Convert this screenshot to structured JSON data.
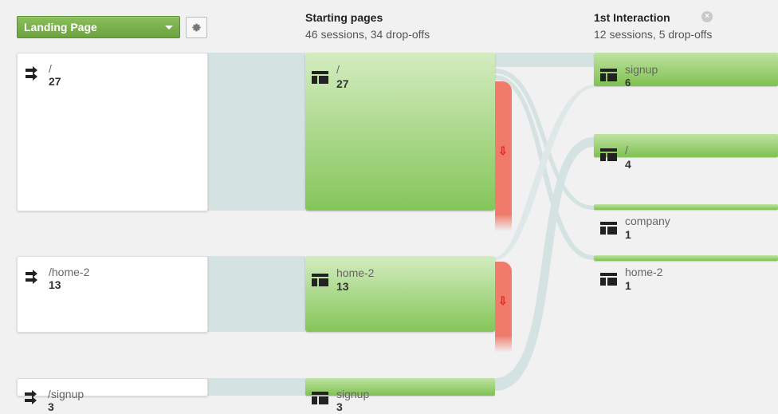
{
  "dimension_selector": {
    "label": "Landing Page",
    "icon": "caret-down-icon"
  },
  "settings": {
    "icon": "gear-icon"
  },
  "columns": [
    {
      "title": "Starting pages",
      "subtitle": "46 sessions, 34 drop-offs"
    },
    {
      "title": "1st Interaction",
      "subtitle": "12 sessions, 5 drop-offs",
      "close_icon": "close-icon"
    }
  ],
  "landing_nodes": [
    {
      "label": "/",
      "count": "27",
      "icon": "arrows-icon"
    },
    {
      "label": "/home-2",
      "count": "13",
      "icon": "arrows-icon"
    },
    {
      "label": "/signup",
      "count": "3",
      "icon": "arrows-icon"
    }
  ],
  "starting_nodes": [
    {
      "label": "/",
      "count": "27",
      "icon": "page-icon"
    },
    {
      "label": "home-2",
      "count": "13",
      "icon": "page-icon"
    },
    {
      "label": "signup",
      "count": "3",
      "icon": "page-icon"
    }
  ],
  "interaction_nodes": [
    {
      "label": "signup",
      "count": "6",
      "icon": "page-icon"
    },
    {
      "label": "/",
      "count": "4",
      "icon": "page-icon"
    },
    {
      "label": "company",
      "count": "1",
      "icon": "page-icon"
    },
    {
      "label": "home-2",
      "count": "1",
      "icon": "page-icon"
    }
  ],
  "colors": {
    "node_green": "#84c659",
    "dropoff_red": "#f07b6b",
    "flow_link": "#d6e3e3",
    "dropoff_arrow": "#e8221a"
  }
}
